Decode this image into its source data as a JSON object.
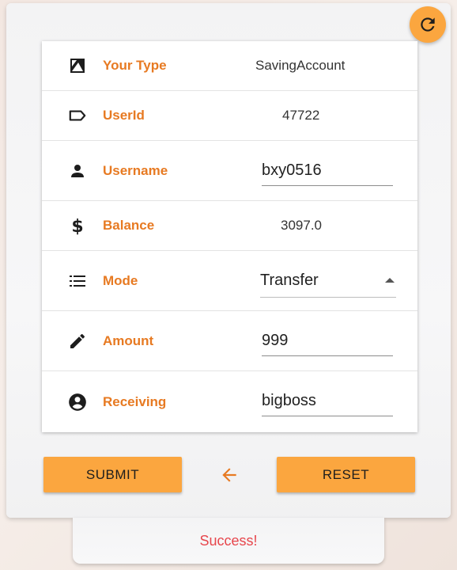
{
  "form": {
    "rows": [
      {
        "label": "Your Type",
        "icon": "account-type-icon",
        "value": "SavingAccount"
      },
      {
        "label": "UserId",
        "icon": "label-tag-icon",
        "value": "47722"
      },
      {
        "label": "Username",
        "icon": "person-icon",
        "value": "bxy0516"
      },
      {
        "label": "Balance",
        "icon": "dollar-icon",
        "value": "3097.0"
      },
      {
        "label": "Mode",
        "icon": "list-icon",
        "value": "Transfer"
      },
      {
        "label": "Amount",
        "icon": "pencil-icon",
        "value": "999"
      },
      {
        "label": "Receiving",
        "icon": "account-circle-icon",
        "value": "bigboss"
      }
    ]
  },
  "actions": {
    "submit_label": "SUBMIT",
    "reset_label": "RESET",
    "back_icon": "arrow-left-icon",
    "refresh_icon": "refresh-icon"
  },
  "status": {
    "message": "Success!"
  },
  "colors": {
    "accent": "#fba63f",
    "label": "#e77a22",
    "success_text": "#e7464c"
  }
}
